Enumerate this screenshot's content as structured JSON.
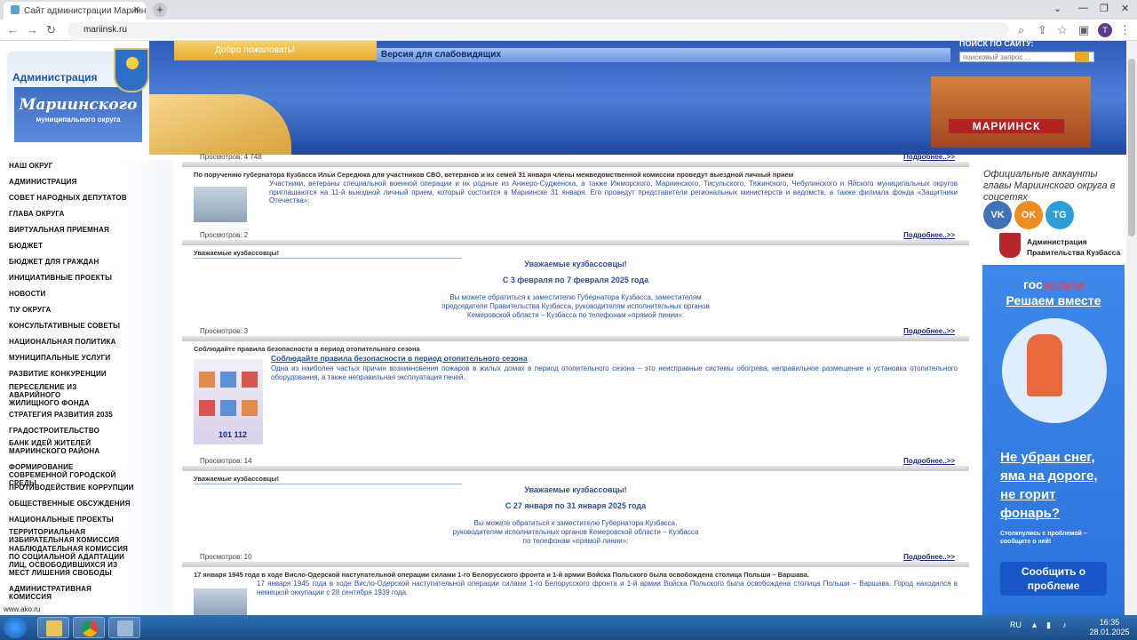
{
  "browser": {
    "active_tab_title": "Сайт администрации Мариинск",
    "url": "mariinsk.ru",
    "avatar_letter": "T",
    "new_tab_glyph": "+"
  },
  "header": {
    "logo_admin": "Администрация",
    "logo_name": "Мариинского",
    "logo_sub": "муниципального округа",
    "welcome": "Добро пожаловать!",
    "low_vision": "Версия для слабовидящих",
    "search_label": "ПОИСК ПО САЙТУ:",
    "search_placeholder": "поисковый запрос ...",
    "fort_label": "МАРИИНСК"
  },
  "left_nav": {
    "items": [
      "НАШ ОКРУГ",
      "АДМИНИСТРАЦИЯ",
      "СОВЕТ НАРОДНЫХ ДЕПУТАТОВ",
      "ГЛАВА ОКРУГА",
      "ВИРТУАЛЬНАЯ ПРИЕМНАЯ",
      "БЮДЖЕТ",
      "БЮДЖЕТ ДЛЯ ГРАЖДАН",
      "ИНИЦИАТИВНЫЕ ПРОЕКТЫ",
      "НОВОСТИ",
      "Т\\У ОКРУГА",
      "КОНСУЛЬТАТИВНЫЕ СОВЕТЫ",
      "НАЦИОНАЛЬНАЯ ПОЛИТИКА",
      "МУНИЦИПАЛЬНЫЕ УСЛУГИ",
      "РАЗВИТИЕ КОНКУРЕНЦИИ",
      "ПЕРЕСЕЛЕНИЕ ИЗ АВАРИЙНОГО ЖИЛИЩНОГО ФОНДА",
      "СТРАТЕГИЯ РАЗВИТИЯ 2035",
      "ГРАДОСТРОИТЕЛЬСТВО",
      "БАНК ИДЕЙ ЖИТЕЛЕЙ МАРИИНСКОГО РАЙОНА",
      "ФОРМИРОВАНИЕ СОВРЕМЕННОЙ ГОРОДСКОЙ СРЕДЫ",
      "ПРОТИВОДЕЙСТВИЕ КОРРУПЦИИ",
      "ОБЩЕСТВЕННЫЕ ОБСУЖДЕНИЯ",
      "НАЦИОНАЛЬНЫЕ ПРОЕКТЫ",
      "ТЕРРИТОРИАЛЬНАЯ ИЗБИРАТЕЛЬНАЯ КОМИССИЯ",
      "НАБЛЮДАТЕЛЬНАЯ КОМИССИЯ ПО СОЦИАЛЬНОЙ АДАПТАЦИИ ЛИЦ, ОСВОБОДИВШИХСЯ ИЗ МЕСТ ЛИШЕНИЯ СВОБОДЫ",
      "АДМИНИСТРАТИВНАЯ КОМИССИЯ"
    ],
    "status_url": "www.ako.ru"
  },
  "news": {
    "more": "Подробнее..>>",
    "n0_views": "Просмотров: 4 748",
    "n1_title": "По поручению губернатора Кузбасса Ильи Середюка для участников СВО, ветеранов и их семей 31 января члены межведомственной комиссии проведут выездной личный прием",
    "n1_text": "Участники, ветераны специальной военной операции и их родные из Анжеро-Судженска, а также Ижморского, Мариинского, Тисульского, Тяжинского, Чебулинского и Яйского муниципальных округов приглашаются на 11-й выездной личный прием, который состоится в Мариинске 31 января. Его проведут представители региональных министерств и ведомств, а также филиала фонда «Защитники Отечества».",
    "n1_views": "Просмотров: 2",
    "n2_title": "Уважаемые кузбассовцы!",
    "n2_head": "Уважаемые кузбассовцы!",
    "n2_dates": "С 3 февраля по 7 февраля 2025 года",
    "n2_l1": "Вы можете обратиться к заместителю Губернатора Кузбасса, заместителям",
    "n2_l2": "председателя Правительства Кузбасса, руководителям исполнительных органов",
    "n2_l3": "Кемеровской области – Кузбасса по телефонам «прямой линии»:",
    "n2_views": "Просмотров: 3",
    "n3_title": "Соблюдайте правила безопасности в период отопительного сезона",
    "n3_head": "Соблюдайте правила безопасности в период отопительного сезона",
    "n3_text": "Одна из наиболее частых причин возникновения пожаров в жилых домах в период отопительного сезона – это неисправные системы обогрева, неправильное размещение и установка отопительного оборудования, а также неправильная эксплуатация печей.",
    "n3_poster_text": "101 112",
    "n3_views": "Просмотров: 14",
    "n4_title": "Уважаемые кузбассовцы!",
    "n4_head": "Уважаемые кузбассовцы!",
    "n4_dates": "С 27 января по 31 января 2025 года",
    "n4_l1": "Вы можете обратиться к заместителю Губернатора Кузбасса,",
    "n4_l2": "руководителям исполнительных органов Кемеровской области – Кузбасса",
    "n4_l3": "по телефонам «прямой линии»:",
    "n4_views": "Просмотров: 10",
    "n5_title": "17 января 1945 года в ходе Висло-Одерской наступательной операции силами 1-го Белорусского фронта и 1-й армии Войска Польского была освобождена столица Польши – Варшава.",
    "n5_text": "17 января 1945 года в ходе Висло-Одерской наступательной операции силами 1-го Белорусского фронта и 1-й армии Войска Польского была освобождена столица Польши – Варшава. Город находился в немецкой оккупации с 28 сентября 1939 года."
  },
  "right": {
    "social_heading": "Официальные аккаунты главы Мариинского округа в соцсетях",
    "vk": "VK",
    "ok": "OK",
    "tg": "TG",
    "kuzbass_label": "Администрация Правительства Кузбасса",
    "gos_a": "гос",
    "gos_b": "услуги",
    "gos_sub": "Решаем вместе",
    "slogan_1": "Не убран снег,",
    "slogan_2": "яма на дороге,",
    "slogan_3": "не горит",
    "slogan_4": "фонарь?",
    "small": "Столкнулись с проблемой – сообщите о ней!",
    "button": "Сообщить о проблеме"
  },
  "taskbar": {
    "lang": "RU",
    "time": "16:35",
    "date": "28.01.2025"
  }
}
